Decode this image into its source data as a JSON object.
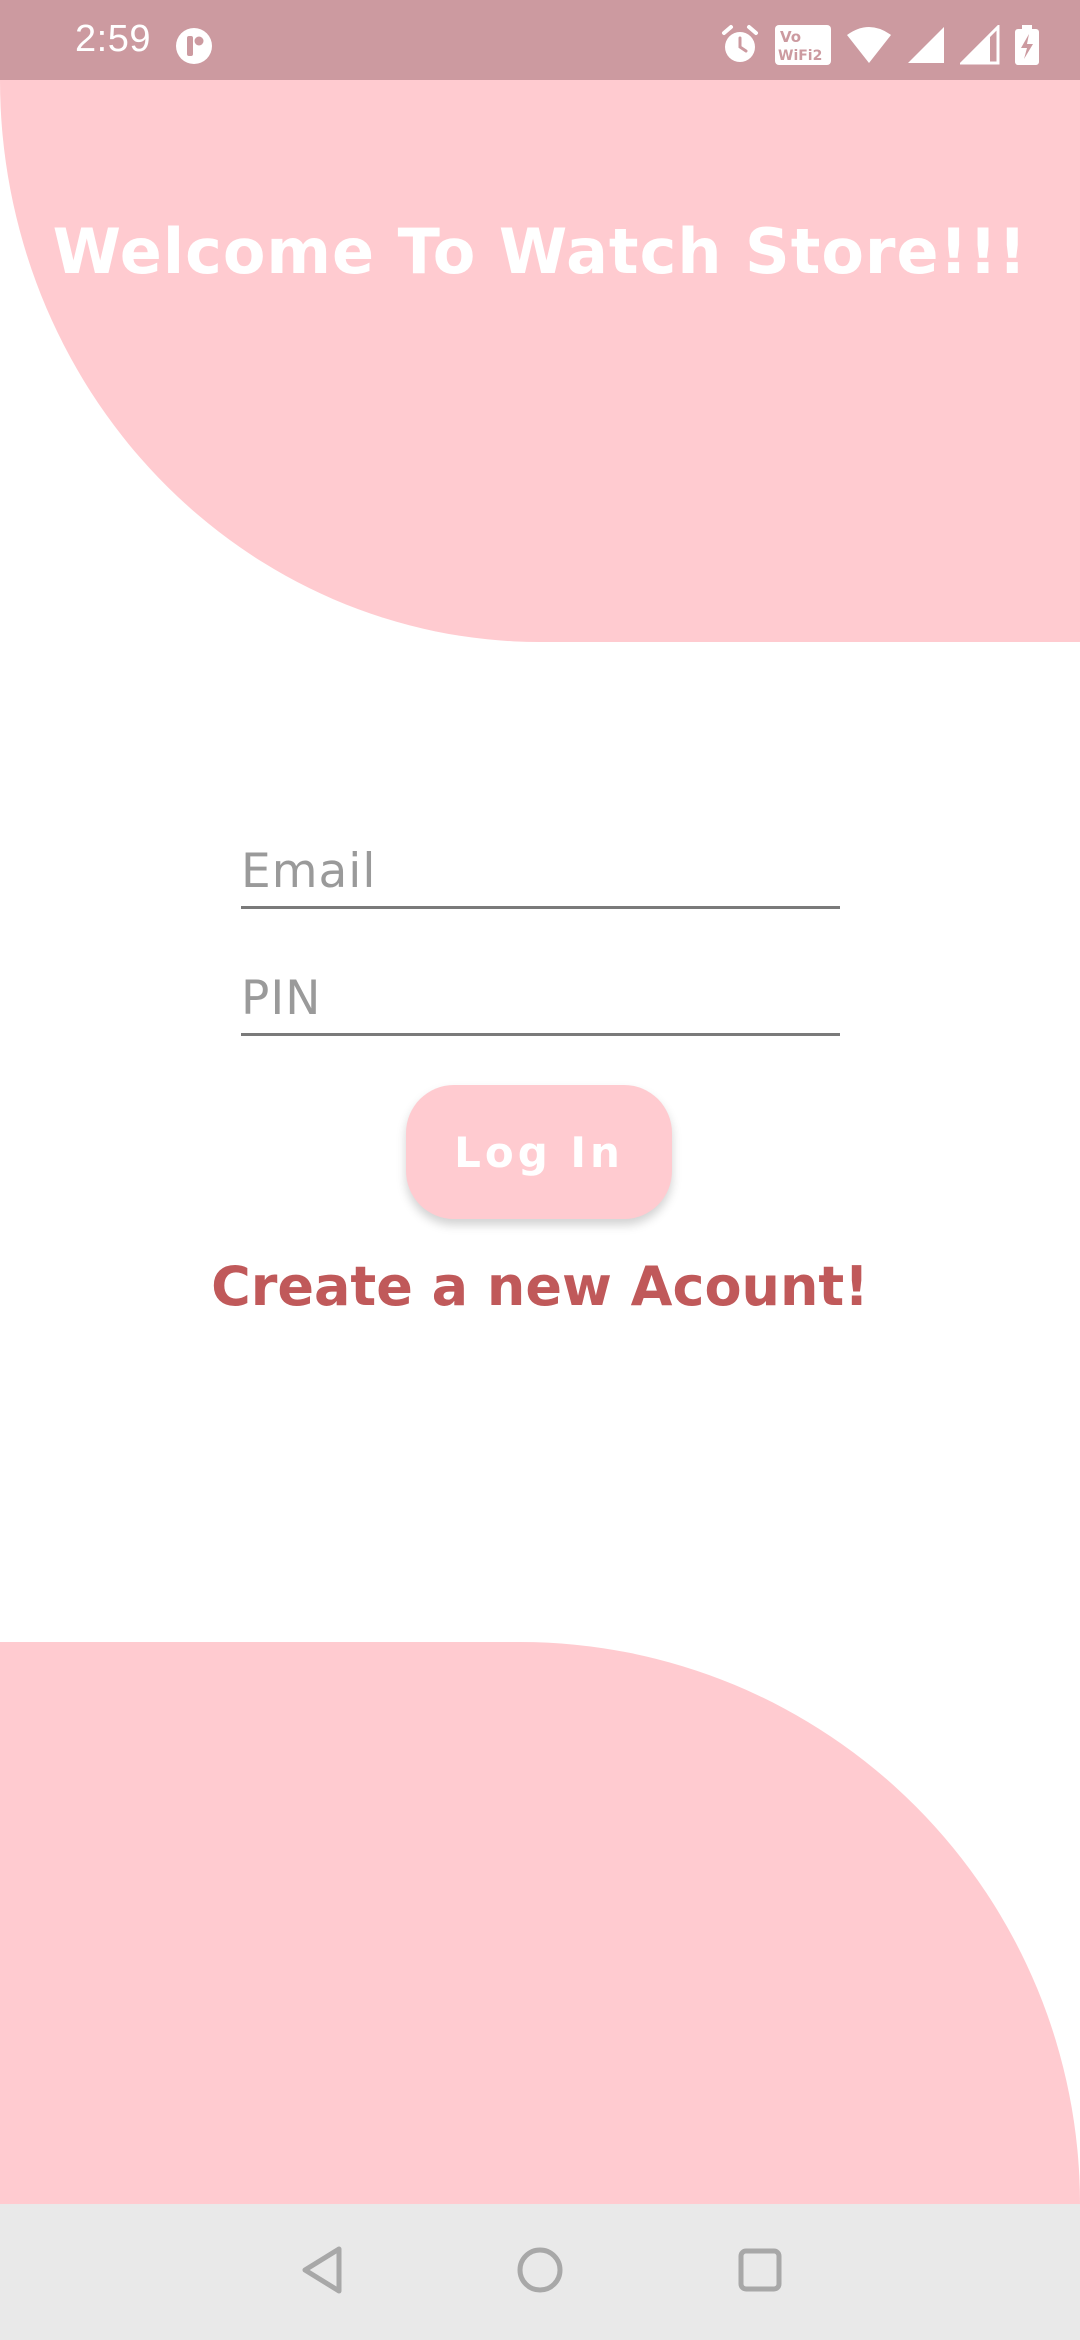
{
  "status_bar": {
    "time": "2:59",
    "icons": [
      "app-notification-icon",
      "alarm-icon",
      "vowifi-icon",
      "wifi-icon",
      "signal-icon",
      "signal-2-icon",
      "battery-charging-icon"
    ],
    "vowifi_line1": "Vo",
    "vowifi_line2": "WiFi2",
    "background_color": "#cc9aa0"
  },
  "header": {
    "title": "Welcome To Watch Store!!!"
  },
  "login_form": {
    "email_placeholder": "Email",
    "email_value": "",
    "pin_placeholder": "PIN",
    "pin_value": "",
    "login_label": "Log In",
    "create_account_label": "Create a new Acount!"
  },
  "navigation_bar": {
    "buttons": [
      "back-icon",
      "home-icon",
      "recents-icon"
    ]
  },
  "colors": {
    "accent_pink": "#ffcbd0",
    "link_red": "#c0595a",
    "status_bar": "#cc9aa0",
    "nav_bar": "#e9e9e9"
  }
}
